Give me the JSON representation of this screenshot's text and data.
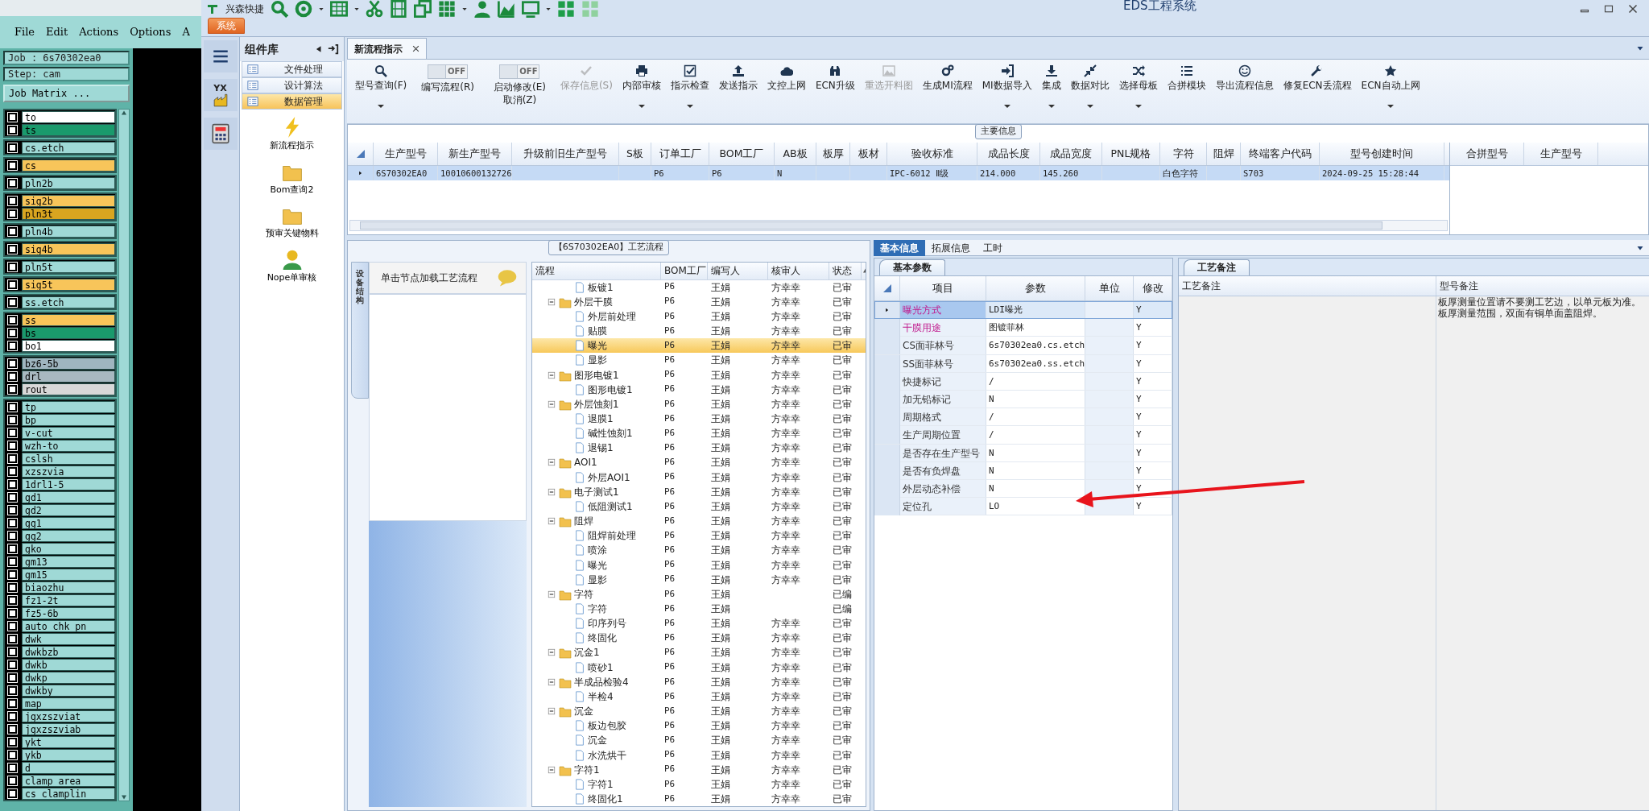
{
  "graphic_editor": {
    "menu": [
      "File",
      "Edit",
      "Actions",
      "Options",
      "A"
    ],
    "job": "Job : 6s70302ea0",
    "step": "Step: cam",
    "job_matrix_button": "Job Matrix ...",
    "layer_groups": [
      [
        {
          "name": "to",
          "color": "#ffffff",
          "checked": false
        },
        {
          "name": "ts",
          "color": "#1a9a6c",
          "checked": false
        }
      ],
      [
        {
          "name": "cs.etch",
          "color": "#9fd9d6",
          "checked": false
        }
      ],
      [
        {
          "name": "cs",
          "color": "#f8c55a",
          "checked": false
        }
      ],
      [
        {
          "name": "pln2b",
          "color": "#9fd9d6",
          "checked": false
        }
      ],
      [
        {
          "name": "sig2b",
          "color": "#f8c55a",
          "checked": false
        },
        {
          "name": "pln3t",
          "color": "#d9a520",
          "checked": false
        }
      ],
      [
        {
          "name": "pln4b",
          "color": "#9fd9d6",
          "checked": false
        }
      ],
      [
        {
          "name": "sig4b",
          "color": "#f8c55a",
          "checked": false
        }
      ],
      [
        {
          "name": "pln5t",
          "color": "#9fd9d6",
          "checked": false
        }
      ],
      [
        {
          "name": "sig5t",
          "color": "#f8c55a",
          "checked": false
        }
      ],
      [
        {
          "name": "ss.etch",
          "color": "#9fd9d6",
          "checked": false
        }
      ],
      [
        {
          "name": "ss",
          "color": "#f8c55a",
          "checked": false
        },
        {
          "name": "bs",
          "color": "#1a9a6c",
          "checked": false
        },
        {
          "name": "bo1",
          "color": "#ffffff",
          "checked": false
        }
      ],
      [
        {
          "name": "bz6-5b",
          "color": "#9fb5bf",
          "checked": false
        },
        {
          "name": "drl",
          "color": "#a8b8c0",
          "checked": false
        },
        {
          "name": "rout",
          "color": "#d8d8d8",
          "checked": false
        }
      ],
      [
        {
          "name": "tp",
          "color": "#9fd9d6",
          "checked": false
        },
        {
          "name": "bp",
          "color": "#9fd9d6",
          "checked": false
        },
        {
          "name": "v-cut",
          "color": "#9fd9d6",
          "checked": false
        },
        {
          "name": "wzh-to",
          "color": "#9fd9d6",
          "checked": false
        },
        {
          "name": "cslsh",
          "color": "#9fd9d6",
          "checked": false
        },
        {
          "name": "xzszvia",
          "color": "#9fd9d6",
          "checked": false
        },
        {
          "name": "1drl1-5",
          "color": "#9fd9d6",
          "checked": false
        },
        {
          "name": "gd1",
          "color": "#9fd9d6",
          "checked": false
        },
        {
          "name": "gd2",
          "color": "#9fd9d6",
          "checked": false
        },
        {
          "name": "gg1",
          "color": "#9fd9d6",
          "checked": false
        },
        {
          "name": "gg2",
          "color": "#9fd9d6",
          "checked": false
        },
        {
          "name": "gko",
          "color": "#9fd9d6",
          "checked": false
        },
        {
          "name": "gm13",
          "color": "#9fd9d6",
          "checked": false
        },
        {
          "name": "gm15",
          "color": "#9fd9d6",
          "checked": false
        },
        {
          "name": "biaozhu",
          "color": "#9fd9d6",
          "checked": false
        },
        {
          "name": "fz1-2t",
          "color": "#9fd9d6",
          "checked": false
        },
        {
          "name": "fz5-6b",
          "color": "#9fd9d6",
          "checked": false
        },
        {
          "name": "auto_chk_pn",
          "color": "#9fd9d6",
          "checked": false
        },
        {
          "name": "dwk",
          "color": "#9fd9d6",
          "checked": false
        },
        {
          "name": "dwkbzb",
          "color": "#9fd9d6",
          "checked": false
        },
        {
          "name": "dwkb",
          "color": "#9fd9d6",
          "checked": false
        },
        {
          "name": "dwkp",
          "color": "#9fd9d6",
          "checked": false
        },
        {
          "name": "dwkby",
          "color": "#9fd9d6",
          "checked": false
        },
        {
          "name": "map",
          "color": "#9fd9d6",
          "checked": false
        },
        {
          "name": "jgxzszviat",
          "color": "#9fd9d6",
          "checked": false
        },
        {
          "name": "jgxzszviab",
          "color": "#9fd9d6",
          "checked": false
        },
        {
          "name": "ykt",
          "color": "#9fd9d6",
          "checked": false
        },
        {
          "name": "ykb",
          "color": "#9fd9d6",
          "checked": false
        },
        {
          "name": "d",
          "color": "#9fd9d6",
          "checked": false
        },
        {
          "name": "clamp_area",
          "color": "#9fd9d6",
          "checked": false
        },
        {
          "name": "cs_clamplin",
          "color": "#9fd9d6",
          "checked": false
        }
      ]
    ]
  },
  "window": {
    "title": "EDS工程系统",
    "quick_access_label": "兴森快捷",
    "ribbon_tab": "系统"
  },
  "nav": {
    "factory_icon_text": "YX"
  },
  "component_library": {
    "title": "组件库",
    "items": [
      {
        "label": "文件处理",
        "selected": false
      },
      {
        "label": "设计算法",
        "selected": false
      },
      {
        "label": "数据管理",
        "selected": true
      }
    ],
    "tiles": [
      "新流程指示",
      "Bom查询2",
      "预审关键物料",
      "Nope单审核"
    ]
  },
  "document_tabs": [
    {
      "label": "新流程指示",
      "selected": true
    }
  ],
  "toolbar": [
    {
      "kind": "button",
      "label": "型号查询(F)",
      "dropdown": true,
      "disabled": false
    },
    {
      "kind": "switch",
      "label": "编写流程(R)",
      "state_text": "OFF",
      "on": false
    },
    {
      "kind": "switch",
      "label": "启动修改(E)\n取消(Z)",
      "state_text": "OFF",
      "on": false
    },
    {
      "kind": "button",
      "label": "保存信息(S)",
      "dropdown": false,
      "disabled": true
    },
    {
      "kind": "button",
      "label": "内部审核",
      "dropdown": true,
      "disabled": false
    },
    {
      "kind": "button",
      "label": "指示检查",
      "dropdown": true,
      "disabled": false
    },
    {
      "kind": "button",
      "label": "发送指示",
      "dropdown": false,
      "disabled": false
    },
    {
      "kind": "button",
      "label": "文控上网",
      "dropdown": false,
      "disabled": false
    },
    {
      "kind": "button",
      "label": "ECN升级",
      "dropdown": false,
      "disabled": false
    },
    {
      "kind": "button",
      "label": "重选开料图",
      "dropdown": false,
      "disabled": true
    },
    {
      "kind": "button",
      "label": "生成MI流程",
      "dropdown": false,
      "disabled": false
    },
    {
      "kind": "button",
      "label": "MI数据导入",
      "dropdown": true,
      "disabled": false
    },
    {
      "kind": "button",
      "label": "集成",
      "dropdown": true,
      "disabled": false
    },
    {
      "kind": "button",
      "label": "数据对比",
      "dropdown": true,
      "disabled": false
    },
    {
      "kind": "button",
      "label": "选择母板",
      "dropdown": true,
      "disabled": false
    },
    {
      "kind": "button",
      "label": "合拼模块",
      "dropdown": false,
      "disabled": false
    },
    {
      "kind": "button",
      "label": "导出流程信息",
      "dropdown": false,
      "disabled": false
    },
    {
      "kind": "button",
      "label": "修复ECN丢流程",
      "dropdown": false,
      "disabled": false
    },
    {
      "kind": "button",
      "label": "ECN自动上网",
      "dropdown": true,
      "disabled": false
    }
  ],
  "main_info": {
    "title": "主要信息",
    "columns": [
      "生产型号",
      "新生产型号",
      "升级前旧生产型号",
      "S板",
      "订单工厂",
      "BOM工厂",
      "AB板",
      "板厚",
      "板材",
      "验收标准",
      "成品长度",
      "成品宽度",
      "PNL规格",
      "字符",
      "阻焊",
      "终端客户代码",
      "型号创建时间"
    ],
    "rows": [
      {
        "selected": true,
        "cells": [
          "6S70302EA0",
          "10010600132726",
          null,
          null,
          "P6",
          "P6",
          "N",
          null,
          null,
          "IPC-6012 Ⅱ级",
          "214.000",
          "145.260",
          null,
          "白色字符",
          null,
          "S703",
          "2024-09-25 15:28:44"
        ]
      }
    ],
    "merge_columns": [
      "合拼型号",
      "生产型号"
    ]
  },
  "process_flow": {
    "title": "【6S70302EA0】工艺流程",
    "side_tab": "设备结构",
    "hint": "单击节点加载工艺流程",
    "columns": [
      "流程",
      "BOM工厂",
      "编写人",
      "核审人",
      "状态"
    ],
    "rows": [
      {
        "kind": "step",
        "name": "板镀1",
        "bom": "P6",
        "writer": "王娟",
        "reviewer": "方幸幸",
        "status": "已审",
        "selected": false
      },
      {
        "kind": "group",
        "name": "外层干膜",
        "bom": "P6",
        "writer": "王娟",
        "reviewer": "方幸幸",
        "status": "已审",
        "selected": false,
        "expanded": true,
        "children": [
          {
            "kind": "step",
            "name": "外层前处理",
            "bom": "P6",
            "writer": "王娟",
            "reviewer": "方幸幸",
            "status": "已审",
            "selected": false
          },
          {
            "kind": "step",
            "name": "贴膜",
            "bom": "P6",
            "writer": "王娟",
            "reviewer": "方幸幸",
            "status": "已审",
            "selected": false
          },
          {
            "kind": "step",
            "name": "曝光",
            "bom": "P6",
            "writer": "王娟",
            "reviewer": "方幸幸",
            "status": "已审",
            "selected": true
          },
          {
            "kind": "step",
            "name": "显影",
            "bom": "P6",
            "writer": "王娟",
            "reviewer": "方幸幸",
            "status": "已审",
            "selected": false
          }
        ]
      },
      {
        "kind": "group",
        "name": "图形电镀1",
        "bom": "P6",
        "writer": "王娟",
        "reviewer": "方幸幸",
        "status": "已审",
        "selected": false,
        "expanded": true,
        "children": [
          {
            "kind": "step",
            "name": "图形电镀1",
            "bom": "P6",
            "writer": "王娟",
            "reviewer": "方幸幸",
            "status": "已审",
            "selected": false
          }
        ]
      },
      {
        "kind": "group",
        "name": "外层蚀刻1",
        "bom": "P6",
        "writer": "王娟",
        "reviewer": "方幸幸",
        "status": "已审",
        "selected": false,
        "expanded": true,
        "children": [
          {
            "kind": "step",
            "name": "退膜1",
            "bom": "P6",
            "writer": "王娟",
            "reviewer": "方幸幸",
            "status": "已审",
            "selected": false
          },
          {
            "kind": "step",
            "name": "碱性蚀刻1",
            "bom": "P6",
            "writer": "王娟",
            "reviewer": "方幸幸",
            "status": "已审",
            "selected": false
          },
          {
            "kind": "step",
            "name": "退锡1",
            "bom": "P6",
            "writer": "王娟",
            "reviewer": "方幸幸",
            "status": "已审",
            "selected": false
          }
        ]
      },
      {
        "kind": "group",
        "name": "AOI1",
        "bom": "P6",
        "writer": "王娟",
        "reviewer": "方幸幸",
        "status": "已审",
        "selected": false,
        "expanded": true,
        "children": [
          {
            "kind": "step",
            "name": "外层AOI1",
            "bom": "P6",
            "writer": "王娟",
            "reviewer": "方幸幸",
            "status": "已审",
            "selected": false
          }
        ]
      },
      {
        "kind": "group",
        "name": "电子测试1",
        "bom": "P6",
        "writer": "王娟",
        "reviewer": "方幸幸",
        "status": "已审",
        "selected": false,
        "expanded": true,
        "children": [
          {
            "kind": "step",
            "name": "低阻测试1",
            "bom": "P6",
            "writer": "王娟",
            "reviewer": "方幸幸",
            "status": "已审",
            "selected": false
          }
        ]
      },
      {
        "kind": "group",
        "name": "阻焊",
        "bom": "P6",
        "writer": "王娟",
        "reviewer": "方幸幸",
        "status": "已审",
        "selected": false,
        "expanded": true,
        "children": [
          {
            "kind": "step",
            "name": "阻焊前处理",
            "bom": "P6",
            "writer": "王娟",
            "reviewer": "方幸幸",
            "status": "已审",
            "selected": false
          },
          {
            "kind": "step",
            "name": "喷涂",
            "bom": "P6",
            "writer": "王娟",
            "reviewer": "方幸幸",
            "status": "已审",
            "selected": false
          },
          {
            "kind": "step",
            "name": "曝光",
            "bom": "P6",
            "writer": "王娟",
            "reviewer": "方幸幸",
            "status": "已审",
            "selected": false
          },
          {
            "kind": "step",
            "name": "显影",
            "bom": "P6",
            "writer": "王娟",
            "reviewer": "方幸幸",
            "status": "已审",
            "selected": false
          }
        ]
      },
      {
        "kind": "group",
        "name": "字符",
        "bom": "P6",
        "writer": "王娟",
        "status": "已编",
        "selected": false,
        "expanded": true,
        "children": [
          {
            "kind": "step",
            "name": "字符",
            "bom": "P6",
            "writer": "王娟",
            "status": "已编",
            "selected": false
          },
          {
            "kind": "step",
            "name": "印序列号",
            "bom": "P6",
            "writer": "王娟",
            "reviewer": "方幸幸",
            "status": "已审",
            "selected": false
          },
          {
            "kind": "step",
            "name": "终固化",
            "bom": "P6",
            "writer": "王娟",
            "reviewer": "方幸幸",
            "status": "已审",
            "selected": false
          }
        ]
      },
      {
        "kind": "group",
        "name": "沉金1",
        "bom": "P6",
        "writer": "王娟",
        "reviewer": "方幸幸",
        "status": "已审",
        "selected": false,
        "expanded": true,
        "children": [
          {
            "kind": "step",
            "name": "喷砂1",
            "bom": "P6",
            "writer": "王娟",
            "reviewer": "方幸幸",
            "status": "已审",
            "selected": false
          }
        ]
      },
      {
        "kind": "group",
        "name": "半成品检验4",
        "bom": "P6",
        "writer": "王娟",
        "reviewer": "方幸幸",
        "status": "已审",
        "selected": false,
        "expanded": true,
        "children": [
          {
            "kind": "step",
            "name": "半检4",
            "bom": "P6",
            "writer": "王娟",
            "reviewer": "方幸幸",
            "status": "已审",
            "selected": false
          }
        ]
      },
      {
        "kind": "group",
        "name": "沉金",
        "bom": "P6",
        "writer": "王娟",
        "reviewer": "方幸幸",
        "status": "已审",
        "selected": false,
        "expanded": true,
        "children": [
          {
            "kind": "step",
            "name": "板边包胶",
            "bom": "P6",
            "writer": "王娟",
            "reviewer": "方幸幸",
            "status": "已审",
            "selected": false
          },
          {
            "kind": "step",
            "name": "沉金",
            "bom": "P6",
            "writer": "王娟",
            "reviewer": "方幸幸",
            "status": "已审",
            "selected": false
          },
          {
            "kind": "step",
            "name": "水洗烘干",
            "bom": "P6",
            "writer": "王娟",
            "reviewer": "方幸幸",
            "status": "已审",
            "selected": false
          }
        ]
      },
      {
        "kind": "group",
        "name": "字符1",
        "bom": "P6",
        "writer": "王娟",
        "reviewer": "方幸幸",
        "status": "已审",
        "selected": false,
        "expanded": true,
        "children": [
          {
            "kind": "step",
            "name": "字符1",
            "bom": "P6",
            "writer": "王娟",
            "reviewer": "方幸幸",
            "status": "已审",
            "selected": false
          },
          {
            "kind": "step",
            "name": "终固化1",
            "bom": "P6",
            "writer": "王娟",
            "reviewer": "方幸幸",
            "status": "已审",
            "selected": false
          }
        ]
      }
    ]
  },
  "detail_tabs": [
    {
      "label": "基本信息",
      "selected": true
    },
    {
      "label": "拓展信息",
      "selected": false
    },
    {
      "label": "工时",
      "selected": false
    }
  ],
  "basic_params": {
    "tab": "基本参数",
    "columns": [
      "项目",
      "参数",
      "单位",
      "修改"
    ],
    "rows": [
      {
        "item": "曝光方式",
        "value": "LDI曝光",
        "modified": "Y",
        "highlighted": true,
        "selected": true
      },
      {
        "item": "干膜用途",
        "value": "图镀菲林",
        "modified": "Y",
        "highlighted": true,
        "selected": false
      },
      {
        "item": "CS面菲林号",
        "value": "6s70302ea0.cs.etch",
        "modified": "Y",
        "highlighted": false,
        "selected": false
      },
      {
        "item": "SS面菲林号",
        "value": "6s70302ea0.ss.etch",
        "modified": "Y",
        "highlighted": false,
        "selected": false
      },
      {
        "item": "快捷标记",
        "value": "/",
        "modified": "Y",
        "highlighted": false,
        "selected": false
      },
      {
        "item": "加无铅标记",
        "value": "N",
        "modified": "Y",
        "highlighted": false,
        "selected": false
      },
      {
        "item": "周期格式",
        "value": "/",
        "modified": "Y",
        "highlighted": false,
        "selected": false
      },
      {
        "item": "生产周期位置",
        "value": "/",
        "modified": "Y",
        "highlighted": false,
        "selected": false
      },
      {
        "item": "是否存在生产型号",
        "value": "N",
        "modified": "Y",
        "highlighted": false,
        "selected": false
      },
      {
        "item": "是否有负焊盘",
        "value": "N",
        "modified": "Y",
        "highlighted": false,
        "selected": false
      },
      {
        "item": "外层动态补偿",
        "value": "N",
        "modified": "Y",
        "highlighted": false,
        "selected": false
      },
      {
        "item": "定位孔",
        "value": "LO",
        "modified": "Y",
        "highlighted": false,
        "selected": false
      }
    ]
  },
  "remarks": {
    "tab": "工艺备注",
    "columns": [
      "工艺备注",
      "型号备注"
    ],
    "model_remarks": [
      "板厚测量位置请不要测工艺边，以单元板为准。",
      "板厚测量范围，双面有铜单面盖阻焊。"
    ]
  }
}
